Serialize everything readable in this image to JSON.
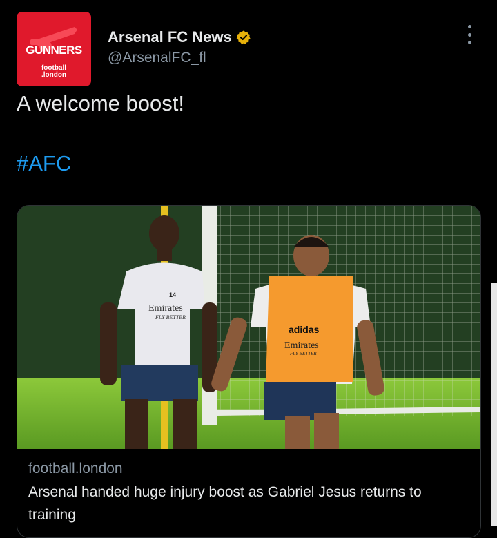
{
  "author": {
    "display_name": "Arsenal FC News",
    "handle": "@ArsenalFC_fl",
    "avatar_brand": "GUNNERS",
    "avatar_sub_1": "football",
    "avatar_sub_2": ".london",
    "verified_icon": "verified-badge-icon"
  },
  "tweet": {
    "text": "A welcome boost!",
    "hashtag": "#AFC"
  },
  "card": {
    "domain": "football.london",
    "title": "Arsenal handed huge injury boost as Gabriel Jesus returns to training",
    "image_kit_left_sponsor": "Emirates",
    "image_kit_left_tagline": "FLY BETTER",
    "image_kit_left_number": "14",
    "image_bib_brand": "adidas",
    "image_bib_sponsor": "Emirates",
    "image_bib_tagline": "FLY BETTER"
  },
  "colors": {
    "background": "#000000",
    "accent_link": "#1d9bf0",
    "avatar_red": "#e0192c",
    "verified_gold": "#e7b10a"
  }
}
